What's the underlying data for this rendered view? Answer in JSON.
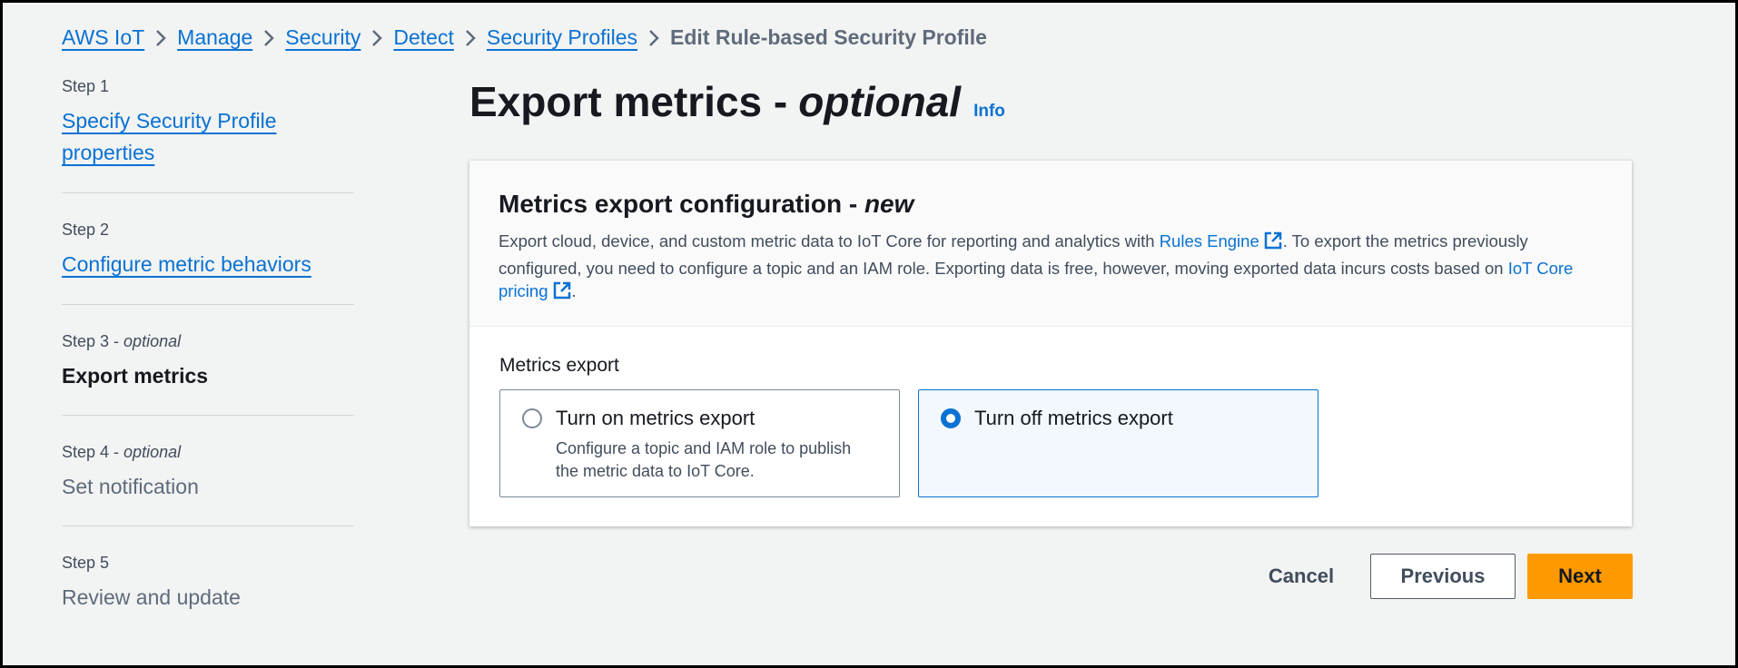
{
  "breadcrumb": {
    "items": [
      "AWS IoT",
      "Manage",
      "Security",
      "Detect",
      "Security Profiles"
    ],
    "current": "Edit Rule-based Security Profile"
  },
  "steps": [
    {
      "num": "Step 1",
      "optional": "",
      "label": "Specify Security Profile properties",
      "state": "link"
    },
    {
      "num": "Step 2",
      "optional": "",
      "label": "Configure metric behaviors",
      "state": "link"
    },
    {
      "num": "Step 3 - ",
      "optional": "optional",
      "label": "Export metrics",
      "state": "active"
    },
    {
      "num": "Step 4 - ",
      "optional": "optional",
      "label": "Set notification",
      "state": "disabled"
    },
    {
      "num": "Step 5",
      "optional": "",
      "label": "Review and update",
      "state": "disabled"
    }
  ],
  "page": {
    "title": "Export metrics -",
    "title_italic": "optional",
    "info": "Info"
  },
  "panel": {
    "title": "Metrics export configuration -",
    "title_italic": "new",
    "desc_1": "Export cloud, device, and custom metric data to IoT Core for reporting and analytics with ",
    "link_rules": "Rules Engine",
    "desc_2": ". To export the metrics previously configured, you need to configure a topic and an IAM role. Exporting data is free, however, moving exported data incurs costs based on ",
    "link_pricing": "IoT Core pricing",
    "desc_3": ".",
    "field_label": "Metrics export",
    "options": [
      {
        "label": "Turn on metrics export",
        "desc": "Configure a topic and IAM role to publish the metric data to IoT Core.",
        "selected": false
      },
      {
        "label": "Turn off metrics export",
        "desc": "",
        "selected": true
      }
    ]
  },
  "actions": {
    "cancel": "Cancel",
    "previous": "Previous",
    "next": "Next"
  },
  "colors": {
    "link": "#0972d3",
    "primary_button": "#ff9900",
    "background": "#f2f3f3"
  }
}
